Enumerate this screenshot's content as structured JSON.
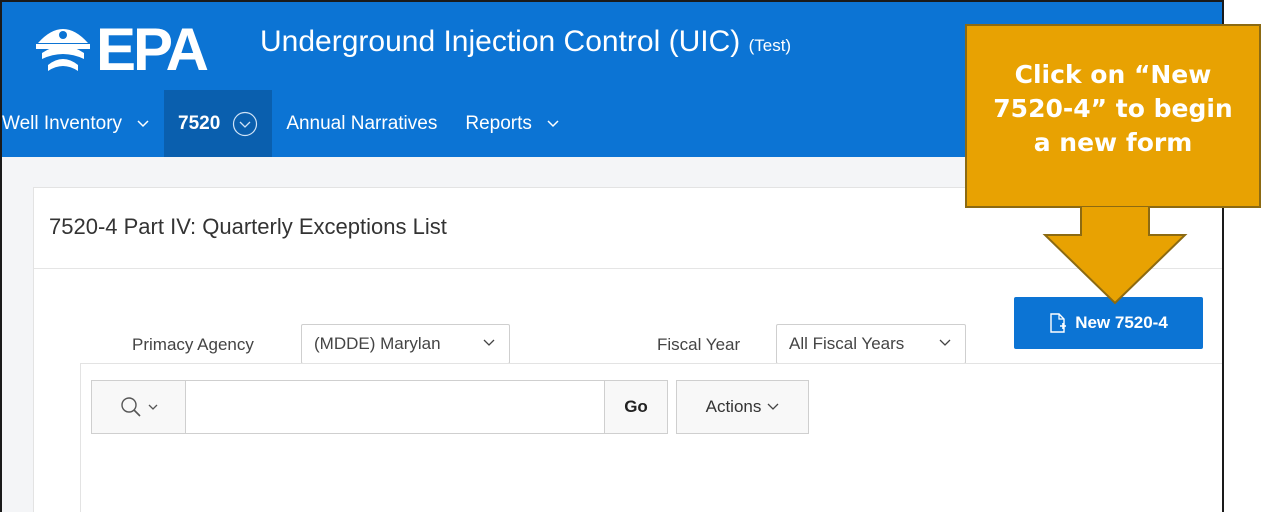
{
  "app": {
    "logo_text": "EPA",
    "title": "Underground Injection Control (UIC)",
    "env": "(Test)"
  },
  "nav": {
    "items": [
      {
        "label": "Well Inventory"
      },
      {
        "label": "7520"
      },
      {
        "label": "Annual Narratives"
      },
      {
        "label": "Reports"
      }
    ]
  },
  "page": {
    "title": "7520-4 Part IV: Quarterly Exceptions List"
  },
  "filters": {
    "primacy_agency_label": "Primacy Agency",
    "primacy_agency_value": "(MDDE) Marylan",
    "fiscal_year_label": "Fiscal Year",
    "fiscal_year_value": "All Fiscal Years"
  },
  "buttons": {
    "new_label": "New 7520-4",
    "go_label": "Go",
    "actions_label": "Actions"
  },
  "search": {
    "value": ""
  },
  "callout": {
    "line1": "Click on “New",
    "line2": "7520-4” to begin",
    "line3": "a new form"
  },
  "colors": {
    "brand_blue": "#0c74d4",
    "active_nav": "#0a5fae",
    "callout_orange": "#e8a202"
  },
  "icons": {
    "logo_mark": "epa-flower-icon",
    "nav_dropdown": "chevron-down-icon",
    "nav_active_menu": "circle-chevron-down-icon",
    "new_button": "new-document-icon",
    "search": "search-icon"
  }
}
